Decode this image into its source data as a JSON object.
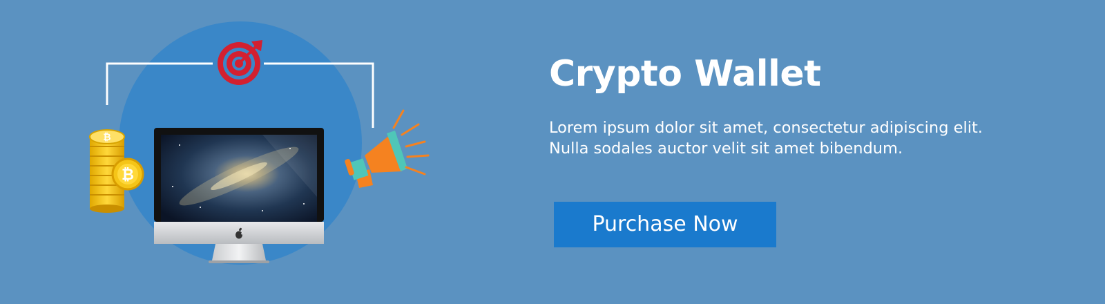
{
  "banner": {
    "title": "Crypto Wallet",
    "description_lines": [
      "Lorem ipsum dolor sit amet, consectetur adipiscing elit.",
      "Nulla sodales auctor velit sit amet bibendum."
    ],
    "cta_label": "Purchase Now"
  },
  "illustration": {
    "items": [
      "target-icon",
      "bitcoin-coins-icon",
      "monitor-icon",
      "megaphone-icon",
      "apple-logo-icon"
    ]
  },
  "colors": {
    "background": "#5b92c1",
    "circle": "#3a87c8",
    "button": "#1a7acd",
    "text": "#ffffff",
    "target_red": "#d32030",
    "megaphone_orange": "#f58220",
    "megaphone_teal": "#4fc6b8",
    "coin_gold": "#f5c518"
  }
}
